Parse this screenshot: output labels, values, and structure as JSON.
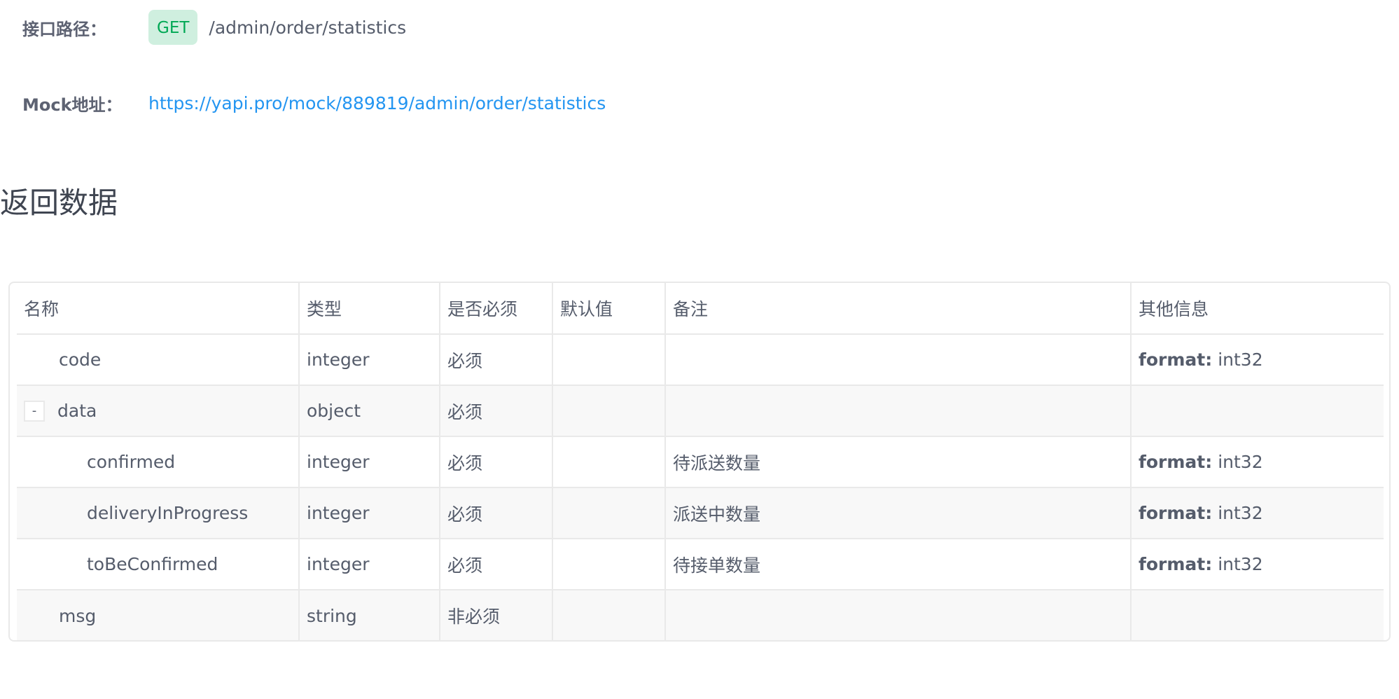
{
  "api": {
    "path_label": "接口路径：",
    "method": "GET",
    "path": "/admin/order/statistics",
    "mock_label": "Mock地址：",
    "mock_url": "https://yapi.pro/mock/889819/admin/order/statistics"
  },
  "section_title": "返回数据",
  "table": {
    "headers": [
      "名称",
      "类型",
      "是否必须",
      "默认值",
      "备注",
      "其他信息"
    ],
    "rows": [
      {
        "name": "code",
        "type": "integer",
        "required": "必须",
        "default": "",
        "note": "",
        "other_key": "format:",
        "other_value": " int32"
      },
      {
        "expander": "-",
        "name": "data",
        "type": "object",
        "required": "必须",
        "default": "",
        "note": "",
        "other_key": "",
        "other_value": ""
      },
      {
        "name": "confirmed",
        "type": "integer",
        "required": "必须",
        "default": "",
        "note": "待派送数量",
        "other_key": "format:",
        "other_value": " int32"
      },
      {
        "name": "deliveryInProgress",
        "type": "integer",
        "required": "必须",
        "default": "",
        "note": "派送中数量",
        "other_key": "format:",
        "other_value": " int32"
      },
      {
        "name": "toBeConfirmed",
        "type": "integer",
        "required": "必须",
        "default": "",
        "note": "待接单数量",
        "other_key": "format:",
        "other_value": " int32"
      },
      {
        "name": "msg",
        "type": "string",
        "required": "非必须",
        "default": "",
        "note": "",
        "other_key": "",
        "other_value": ""
      }
    ]
  },
  "colors": {
    "method_badge_bg": "#cfefdf",
    "method_badge_text": "#00a854",
    "link": "#2395f1"
  }
}
